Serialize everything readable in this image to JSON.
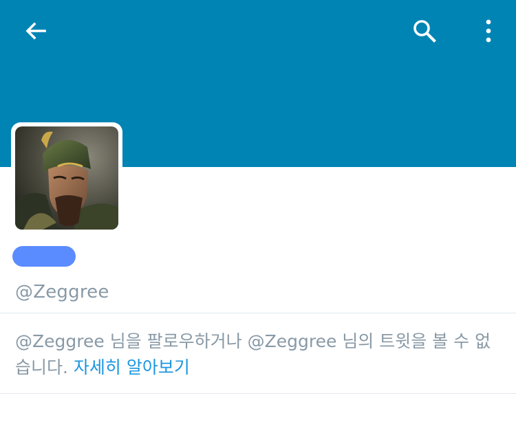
{
  "header": {
    "back_icon": "arrow-left-icon",
    "search_icon": "search-icon",
    "more_icon": "more-vertical-icon",
    "banner_color": "#0084b4"
  },
  "profile": {
    "avatar": "profile-avatar",
    "handle": "@Zeggree",
    "name_redaction_color": "#5b8cff"
  },
  "protected_notice": {
    "handle_1": "@Zeggree",
    "text_1": " 님을 팔로우하거나 ",
    "handle_2": "@Zeggree",
    "text_2": " 님의 트윗을 볼 수 없습니다. ",
    "learn_more_label": "자세히 알아보기",
    "link_color": "#1b95e0"
  }
}
